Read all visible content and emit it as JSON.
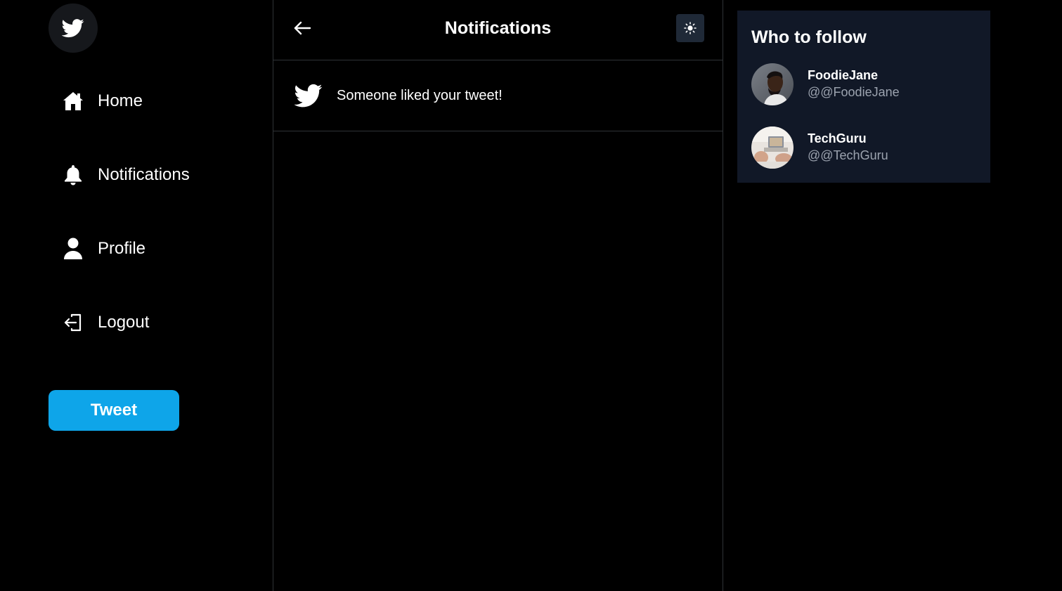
{
  "sidebar": {
    "logo_icon": "twitter-bird-icon",
    "nav": [
      {
        "label": "Home",
        "icon": "home-icon"
      },
      {
        "label": "Notifications",
        "icon": "bell-icon"
      },
      {
        "label": "Profile",
        "icon": "user-icon"
      },
      {
        "label": "Logout",
        "icon": "logout-icon"
      }
    ],
    "tweet_button": "Tweet"
  },
  "header": {
    "title": "Notifications",
    "back_icon": "arrow-left-icon",
    "theme_icon": "sun-icon"
  },
  "notifications": [
    {
      "icon": "twitter-bird-icon",
      "text": "Someone liked your tweet!"
    }
  ],
  "who_to_follow": {
    "title": "Who to follow",
    "users": [
      {
        "name": "FoodieJane",
        "handle": "@@FoodieJane"
      },
      {
        "name": "TechGuru",
        "handle": "@@TechGuru"
      }
    ]
  },
  "colors": {
    "accent": "#0ea5e9",
    "panel_bg": "#111827",
    "background": "#000000",
    "border": "#2f3336",
    "muted_text": "#9ca3af"
  }
}
